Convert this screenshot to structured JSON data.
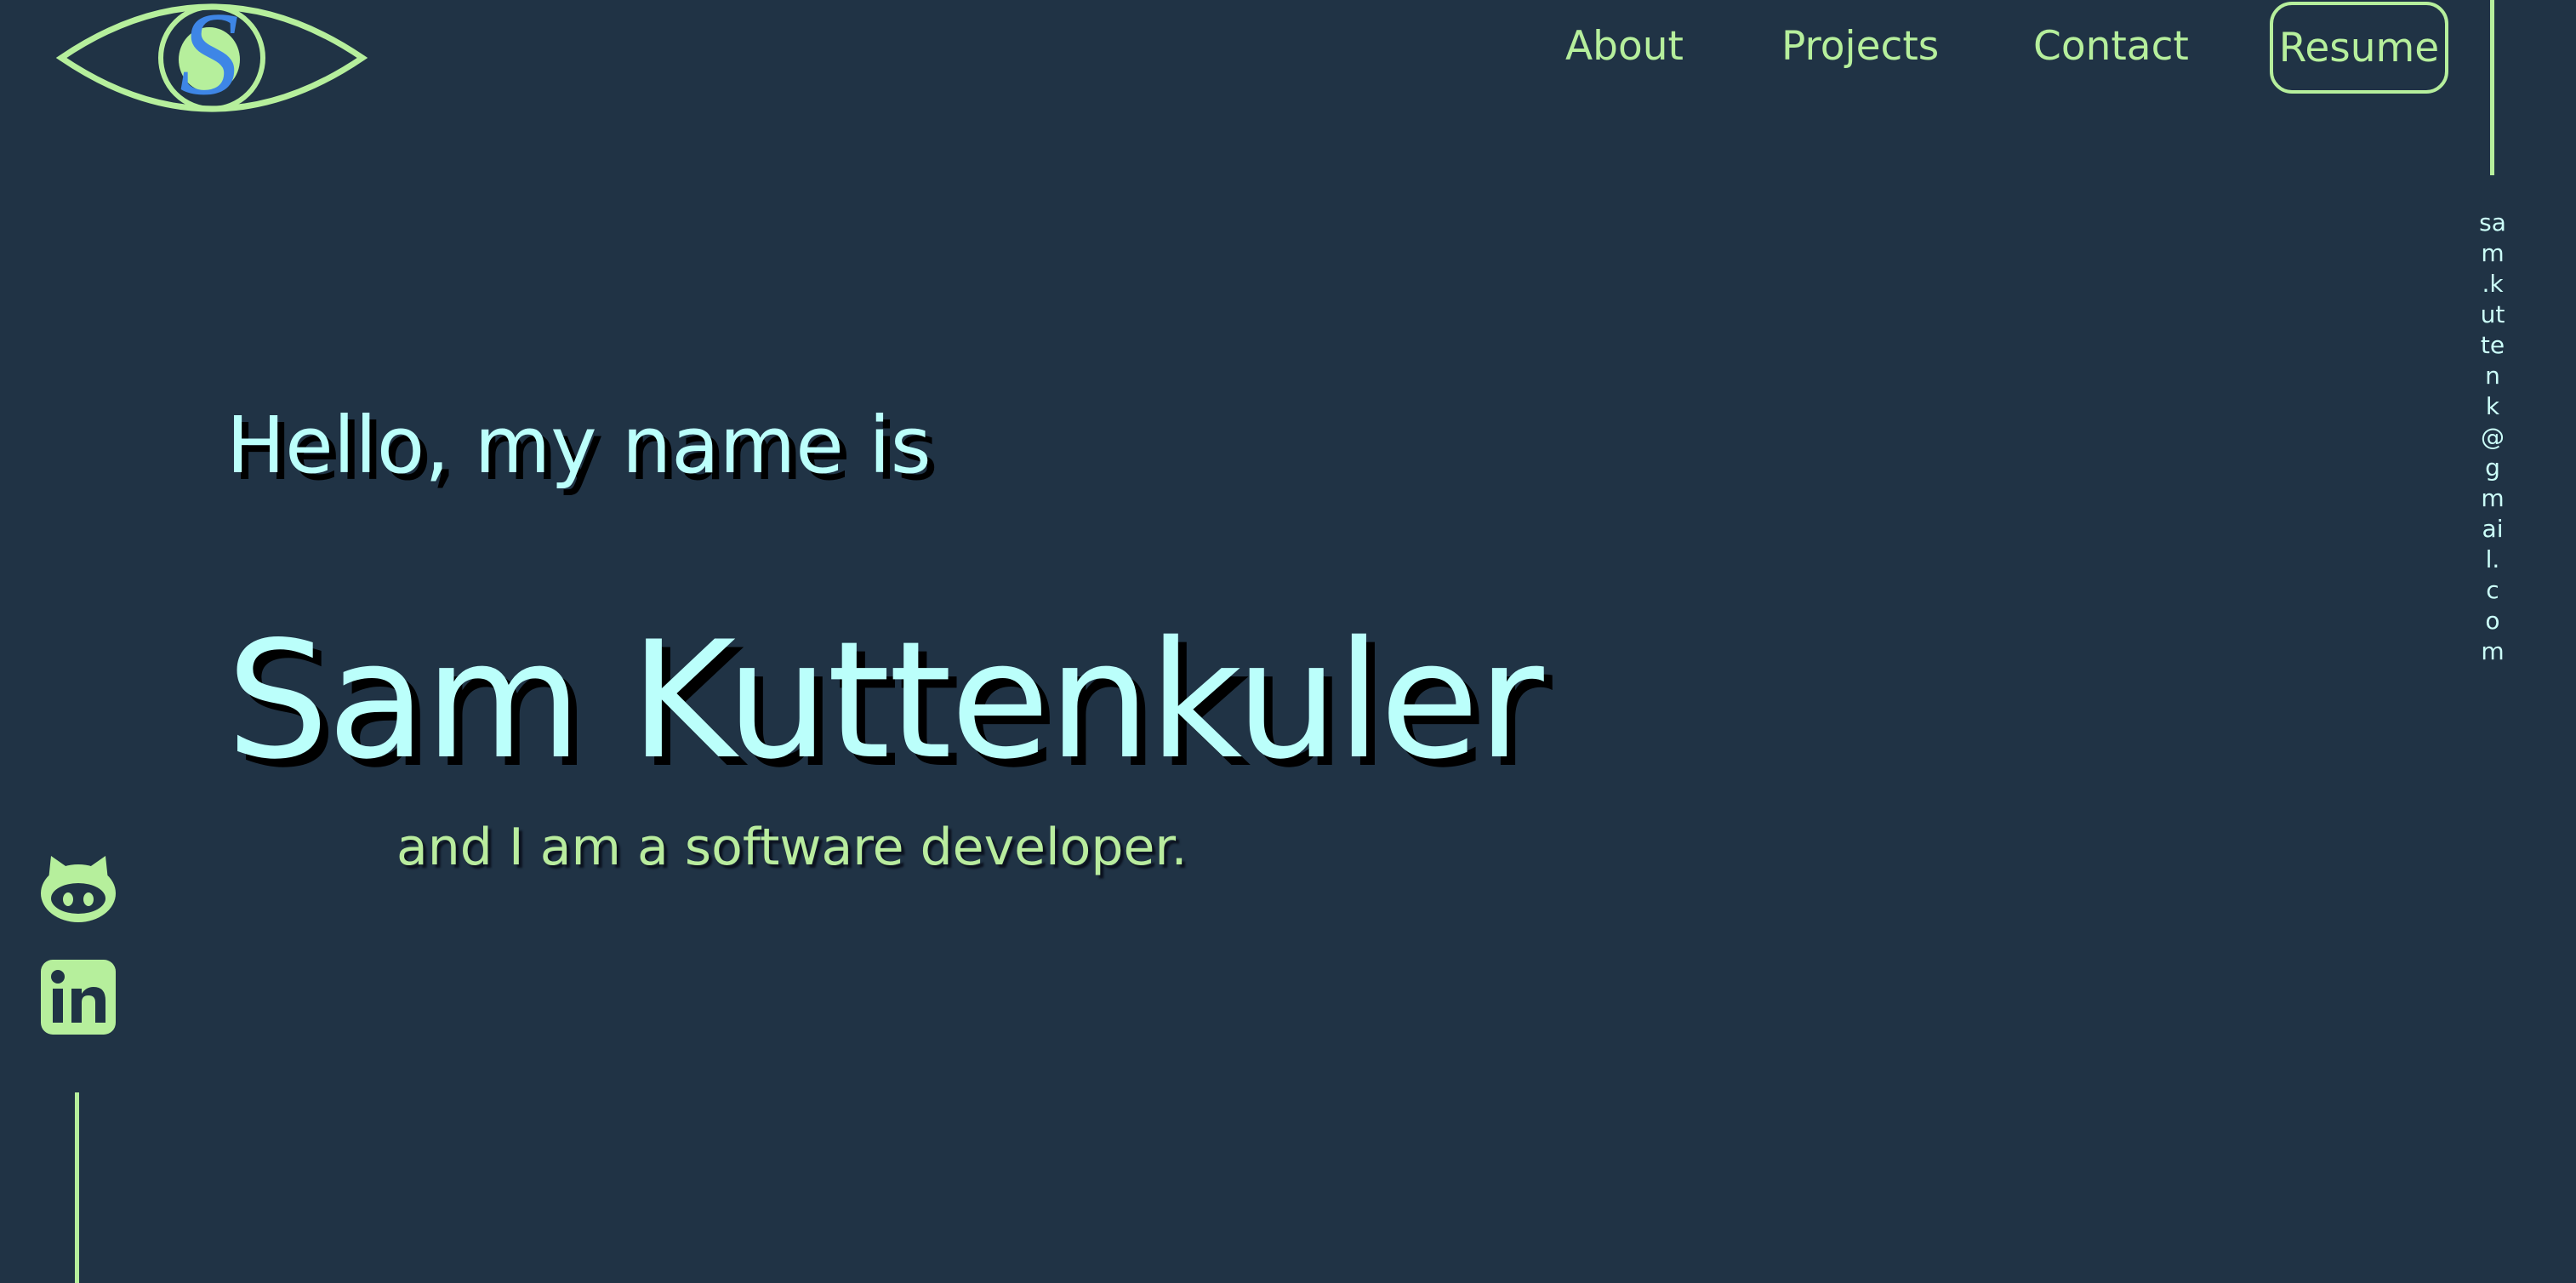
{
  "colors": {
    "background": "#203345",
    "accent_green": "#b6ef9c",
    "hero_text": "#bbfffb",
    "logo_blue": "#3e86e6"
  },
  "logo": {
    "letter": "S",
    "icon": "eye-icon"
  },
  "nav": {
    "items": [
      {
        "label": "About"
      },
      {
        "label": "Projects"
      },
      {
        "label": "Contact"
      }
    ],
    "resume_label": "Resume"
  },
  "email": "sam.kuttenk@gmail.com",
  "hero": {
    "greeting": "Hello, my name is",
    "name": "Sam Kuttenkuler",
    "tagline": "and I am a software developer."
  },
  "social": {
    "github_icon": "github-icon",
    "linkedin_icon": "linkedin-icon"
  }
}
